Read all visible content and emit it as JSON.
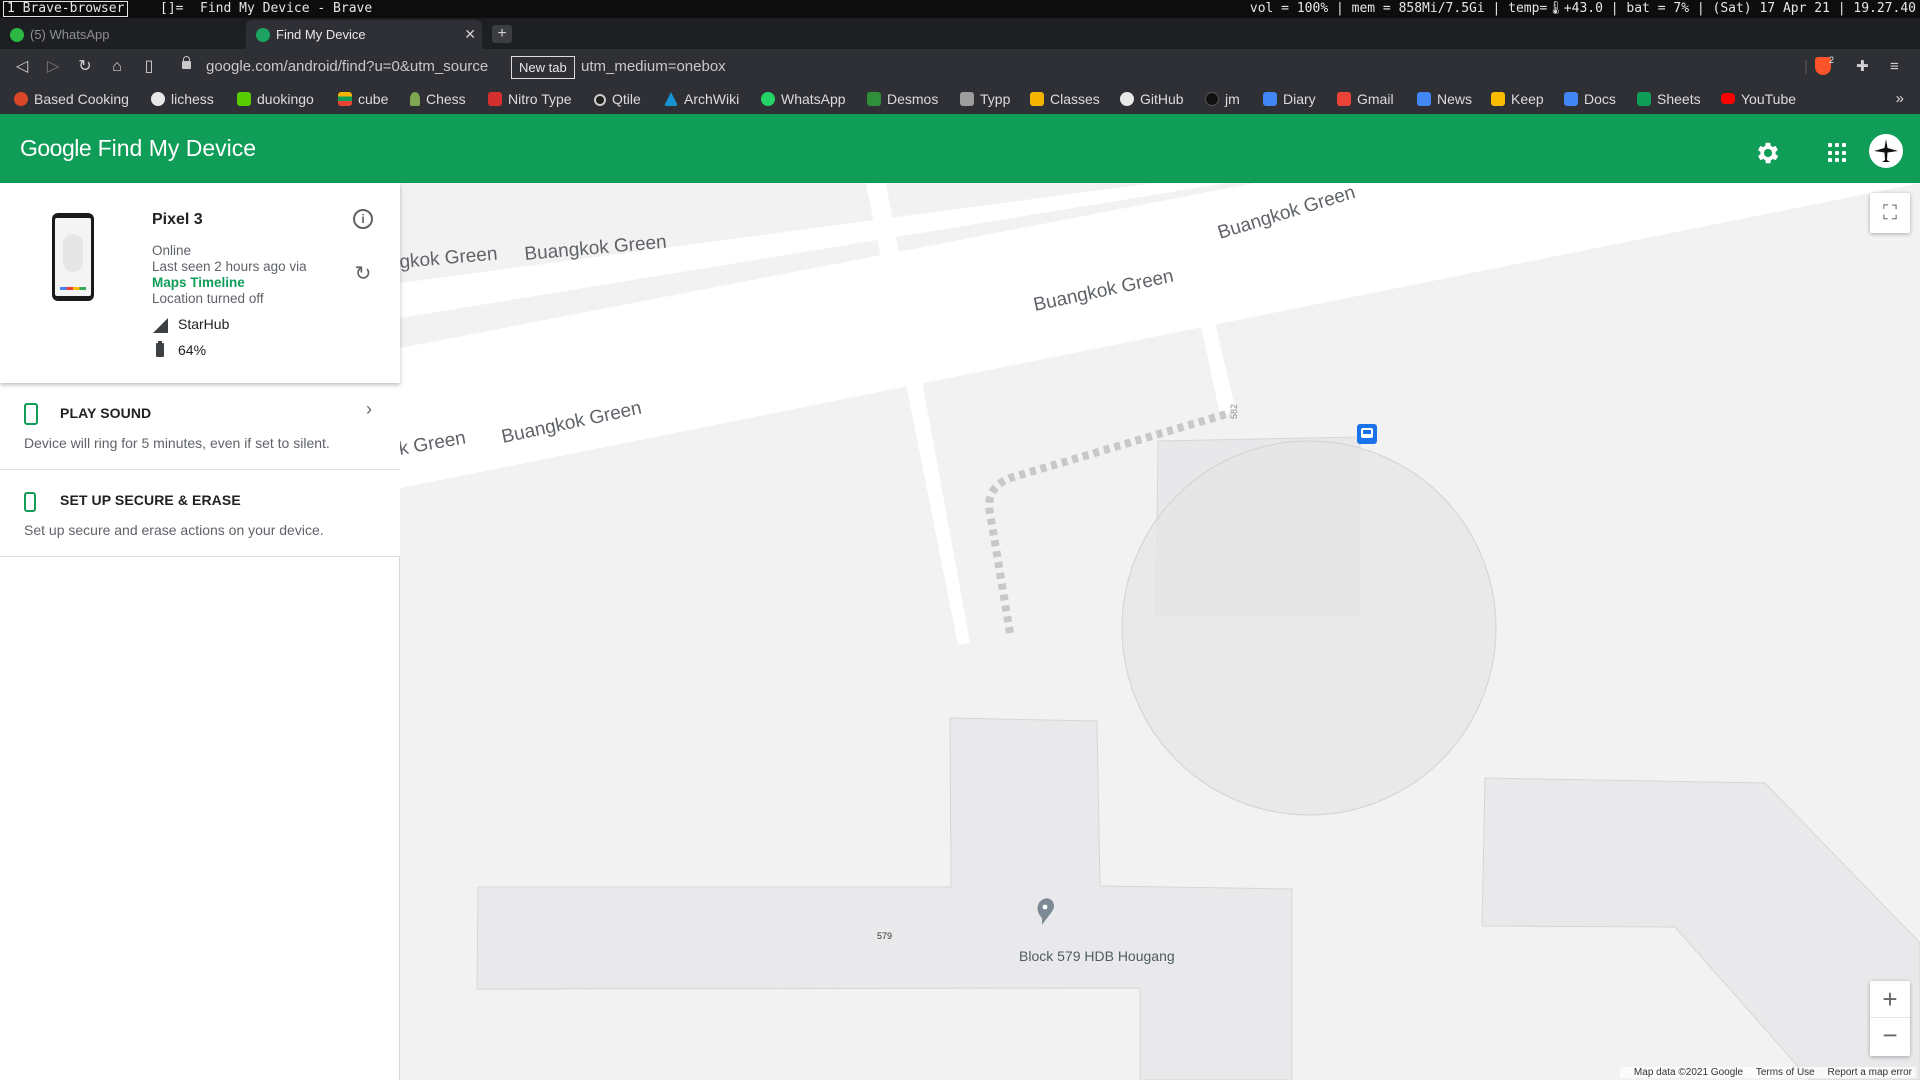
{
  "wm": {
    "workspace": "1 Brave-browser",
    "layout": "[]=",
    "window_title": "Find My Device - Brave",
    "status": "vol = 100% | mem = 858Mi/7.5Gi | temp=🌡+43.0 | bat = 7% | (Sat) 17 Apr 21 | 19.27.40"
  },
  "tabs": [
    {
      "label": "(5) WhatsApp",
      "active": false
    },
    {
      "label": "Find My Device",
      "active": true
    }
  ],
  "toolbar": {
    "url": "google.com/android/find?u=0&utm_source New tab utm_medium=onebox",
    "url_left": "google.com/android/find?u=0&utm_source",
    "url_right": "utm_medium=onebox",
    "tooltip": "New tab",
    "brave_badge": "2"
  },
  "bookmarks": [
    {
      "label": "Based Cooking",
      "color": "#d9472b"
    },
    {
      "label": "lichess",
      "color": "#e8e8e8"
    },
    {
      "label": "duokingo",
      "color": "#58cc02"
    },
    {
      "label": "cube",
      "color": "#f4b400"
    },
    {
      "label": "Chess",
      "color": "#7fa650"
    },
    {
      "label": "Nitro Type",
      "color": "#d62f2f"
    },
    {
      "label": "Qtile",
      "color": "#222222"
    },
    {
      "label": "ArchWiki",
      "color": "#1793d1"
    },
    {
      "label": "WhatsApp",
      "color": "#25d366"
    },
    {
      "label": "Desmos",
      "color": "#2f8f3a"
    },
    {
      "label": "Typp",
      "color": "#9e9e9e"
    },
    {
      "label": "Classes",
      "color": "#f4b400"
    },
    {
      "label": "GitHub",
      "color": "#e8e8e8"
    },
    {
      "label": "jm",
      "color": "#111111"
    },
    {
      "label": "Diary",
      "color": "#4285f4"
    },
    {
      "label": "Gmail",
      "color": "#ea4335"
    },
    {
      "label": "News",
      "color": "#4285f4"
    },
    {
      "label": "Keep",
      "color": "#fbbc04"
    },
    {
      "label": "Docs",
      "color": "#4285f4"
    },
    {
      "label": "Sheets",
      "color": "#0f9d58"
    },
    {
      "label": "YouTube",
      "color": "#ff0000"
    }
  ],
  "header": {
    "logo_google": "Google",
    "logo_product": "Find My Device"
  },
  "device": {
    "name": "Pixel 3",
    "status": "Online",
    "last_seen": "Last seen 2 hours ago via",
    "source": "Maps Timeline",
    "location": "Location turned off",
    "carrier": "StarHub",
    "battery": "64%"
  },
  "actions": [
    {
      "title": "PLAY SOUND",
      "desc": "Device will ring for 5 minutes, even if set to silent."
    },
    {
      "title": "SET UP SECURE & ERASE",
      "desc": "Set up secure and erase actions on your device."
    }
  ],
  "map": {
    "street_labels": [
      "gkok Green",
      "Buangkok Green",
      "Buangkok Green",
      "Buangkok Green",
      "k Green",
      "Buangkok Green"
    ],
    "block_582": "582",
    "block_579": "579",
    "place_label": "Block 579 HDB Hougang",
    "footer": [
      "Map data ©2021 Google",
      "Terms of Use",
      "Report a map error"
    ],
    "zoom_in": "+",
    "zoom_out": "−"
  },
  "colors": {
    "brand_green": "#0f9d58",
    "map_bg": "#f2f2f2",
    "road": "#ffffff",
    "building": "#e9e9eb",
    "accuracy_circle": "#e6e6e6"
  }
}
